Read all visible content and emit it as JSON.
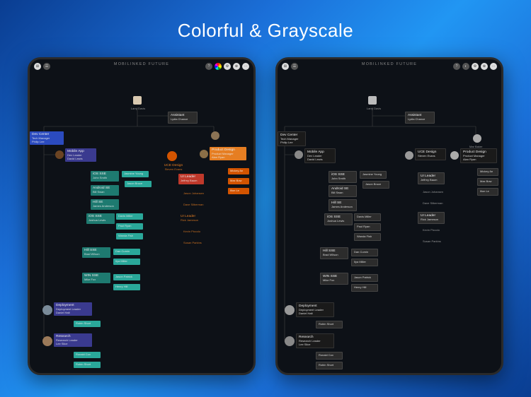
{
  "title": "Colorful & Grayscale",
  "app_title": "MOBILINKED FUTURE",
  "toolbar_icons": [
    "grid",
    "list",
    "palette",
    "settings",
    "add",
    "more"
  ],
  "root": {
    "name": "Larry Davis",
    "role": ""
  },
  "assistant": {
    "role": "Assistant",
    "name": "Lydia Chance"
  },
  "dev_center": {
    "title": "Dev Center",
    "role": "Tech Manager",
    "name": "Philip Lee"
  },
  "mobile_app": {
    "title": "Mobile App",
    "role": "Dev Leader",
    "name": "David Lewis"
  },
  "uce_design": {
    "title": "UCE Design",
    "role": "",
    "name": "Steven Evans"
  },
  "prod_design": {
    "title": "Product Design",
    "role": "Product Manager",
    "name": "Alan Ryan"
  },
  "mar_baker": {
    "name": "Mar Baker"
  },
  "dev_nodes": [
    {
      "title": "iOS SSE",
      "name": "John Smith"
    },
    {
      "title": "Android SE",
      "name": "Bill Swan"
    },
    {
      "title": "Hill SE",
      "name": "James Anderson"
    },
    {
      "title": "iOS SSE",
      "name": "Joshua Lewis"
    },
    {
      "title": "Hill SSE",
      "name": "Brad Wilson"
    },
    {
      "title": "WIN SSE",
      "name": "Mike Fox"
    }
  ],
  "dev_right_nodes": [
    {
      "name": "Jasmine Young"
    },
    {
      "name": "Jason Bruce"
    },
    {
      "name": "Davis Miller"
    },
    {
      "name": "Paul Ryan"
    },
    {
      "name": "Wanda Fish"
    },
    {
      "name": "Dan Cumin"
    },
    {
      "name": "Ilya Miller"
    },
    {
      "name": "Jason Patrick"
    },
    {
      "name": "Henry Hill"
    }
  ],
  "design_nodes": [
    {
      "title": "UI Leader",
      "name": "Jeffrey Baum"
    },
    {
      "name": "Jason Johansen"
    },
    {
      "name": "Dave Silberman"
    },
    {
      "title": "UI Leader",
      "name": "Rick Jameson"
    },
    {
      "name": "Kevin Piccolo"
    },
    {
      "name": "Susan Parkins"
    }
  ],
  "prod_nodes": [
    {
      "name": "Mickey An"
    },
    {
      "name": "Max Bow"
    },
    {
      "name": "Ilion Le"
    }
  ],
  "deployment": {
    "title": "Deployment",
    "role": "Deployment Leader",
    "name": "Daniel Halt"
  },
  "dep_nodes": [
    {
      "name": "Robin Short"
    }
  ],
  "research": {
    "title": "Research",
    "role": "Research Leader",
    "name": "Lee Slice"
  },
  "res_nodes": [
    {
      "name": "Ronald Cox"
    },
    {
      "name": "Robin Short"
    }
  ]
}
